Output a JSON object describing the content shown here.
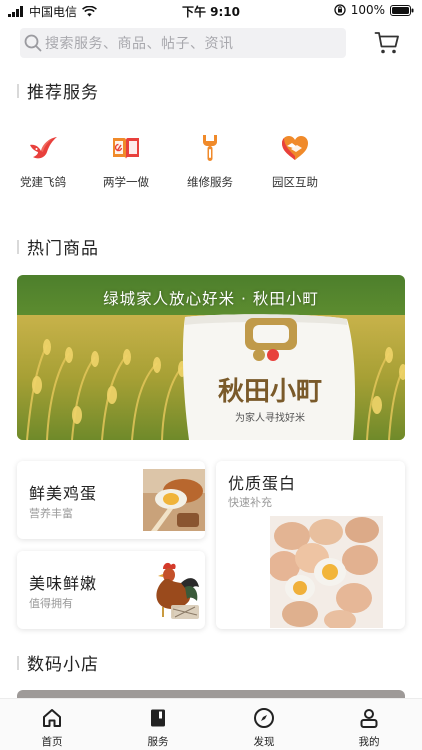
{
  "status_bar": {
    "carrier": "中国电信",
    "time": "下午 9:10",
    "battery": "100%"
  },
  "search": {
    "placeholder": "搜索服务、商品、帖子、资讯"
  },
  "sections": {
    "recommended": "推荐服务",
    "hot_products": "热门商品",
    "digital_store": "数码小店"
  },
  "services": [
    {
      "label": "党建飞鸽",
      "icon": "dove-icon"
    },
    {
      "label": "两学一做",
      "icon": "party-book-icon"
    },
    {
      "label": "维修服务",
      "icon": "wrench-icon"
    },
    {
      "label": "园区互助",
      "icon": "heart-hands-icon"
    }
  ],
  "banner": {
    "headline": "绿城家人放心好米 · 秋田小町",
    "bag_title": "秋田小町",
    "bag_slogan": "为家人寻找好米"
  },
  "products": [
    {
      "title": "鲜美鸡蛋",
      "subtitle": "营养丰富"
    },
    {
      "title": "美味鲜嫩",
      "subtitle": "值得拥有"
    },
    {
      "title": "优质蛋白",
      "subtitle": "快速补充"
    }
  ],
  "tabs": [
    {
      "label": "首页",
      "icon": "home-icon"
    },
    {
      "label": "服务",
      "icon": "book-icon"
    },
    {
      "label": "发现",
      "icon": "compass-icon"
    },
    {
      "label": "我的",
      "icon": "user-icon"
    }
  ],
  "colors": {
    "accent_red": "#e8403c",
    "accent_orange": "#f08a2a",
    "search_bg": "#f1f1f3"
  }
}
